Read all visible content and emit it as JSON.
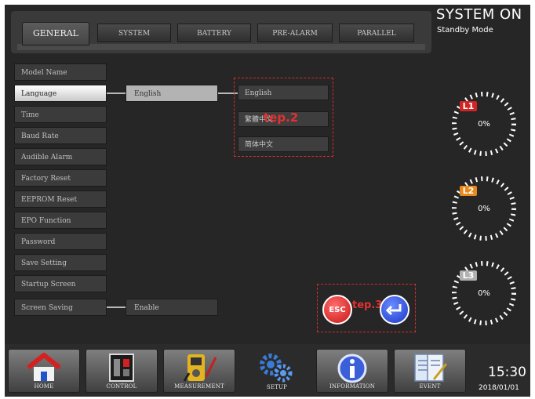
{
  "tabs": [
    {
      "label": "GENERAL",
      "active": true
    },
    {
      "label": "SYSTEM",
      "active": false
    },
    {
      "label": "BATTERY",
      "active": false
    },
    {
      "label": "PRE-ALARM",
      "active": false
    },
    {
      "label": "PARALLEL",
      "active": false
    }
  ],
  "settings": [
    {
      "label": "Model Name"
    },
    {
      "label": "Language",
      "selected": true
    },
    {
      "label": "Time"
    },
    {
      "label": "Baud Rate"
    },
    {
      "label": "Audible Alarm"
    },
    {
      "label": "Factory Reset"
    },
    {
      "label": "EEPROM Reset"
    },
    {
      "label": "EPO Function"
    },
    {
      "label": "Password"
    },
    {
      "label": "Save Setting"
    },
    {
      "label": "Startup Screen"
    },
    {
      "label": "Screen Saving"
    }
  ],
  "language_value": "English",
  "screen_saving_value": "Enable",
  "language_options": [
    "English",
    "繁體中文",
    "简体中文"
  ],
  "annotations": {
    "step2": "tep.2",
    "step3": "tep.3"
  },
  "buttons": {
    "esc_label": "ESC",
    "enter_icon": "enter-arrow-icon"
  },
  "status": {
    "system": "SYSTEM ON",
    "mode": "Standby Mode"
  },
  "gauges": [
    {
      "badge": "L1",
      "value": "0%",
      "badge_color": "#d42323",
      "level": 0
    },
    {
      "badge": "L2",
      "value": "0%",
      "badge_color": "#e8891c",
      "level": 0
    },
    {
      "badge": "L3",
      "value": "0%",
      "badge_color": "#b0b0b0",
      "level": 0
    }
  ],
  "nav": [
    {
      "label": "HOME",
      "icon": "home-icon"
    },
    {
      "label": "CONTROL",
      "icon": "control-panel-icon"
    },
    {
      "label": "MEASUREMENT",
      "icon": "multimeter-icon"
    },
    {
      "label": "SETUP",
      "icon": "gears-icon",
      "active": true
    },
    {
      "label": "INFORMATION",
      "icon": "info-icon"
    },
    {
      "label": "EVENT",
      "icon": "event-log-icon"
    }
  ],
  "clock": {
    "time": "15:30",
    "date": "2018/01/01"
  }
}
